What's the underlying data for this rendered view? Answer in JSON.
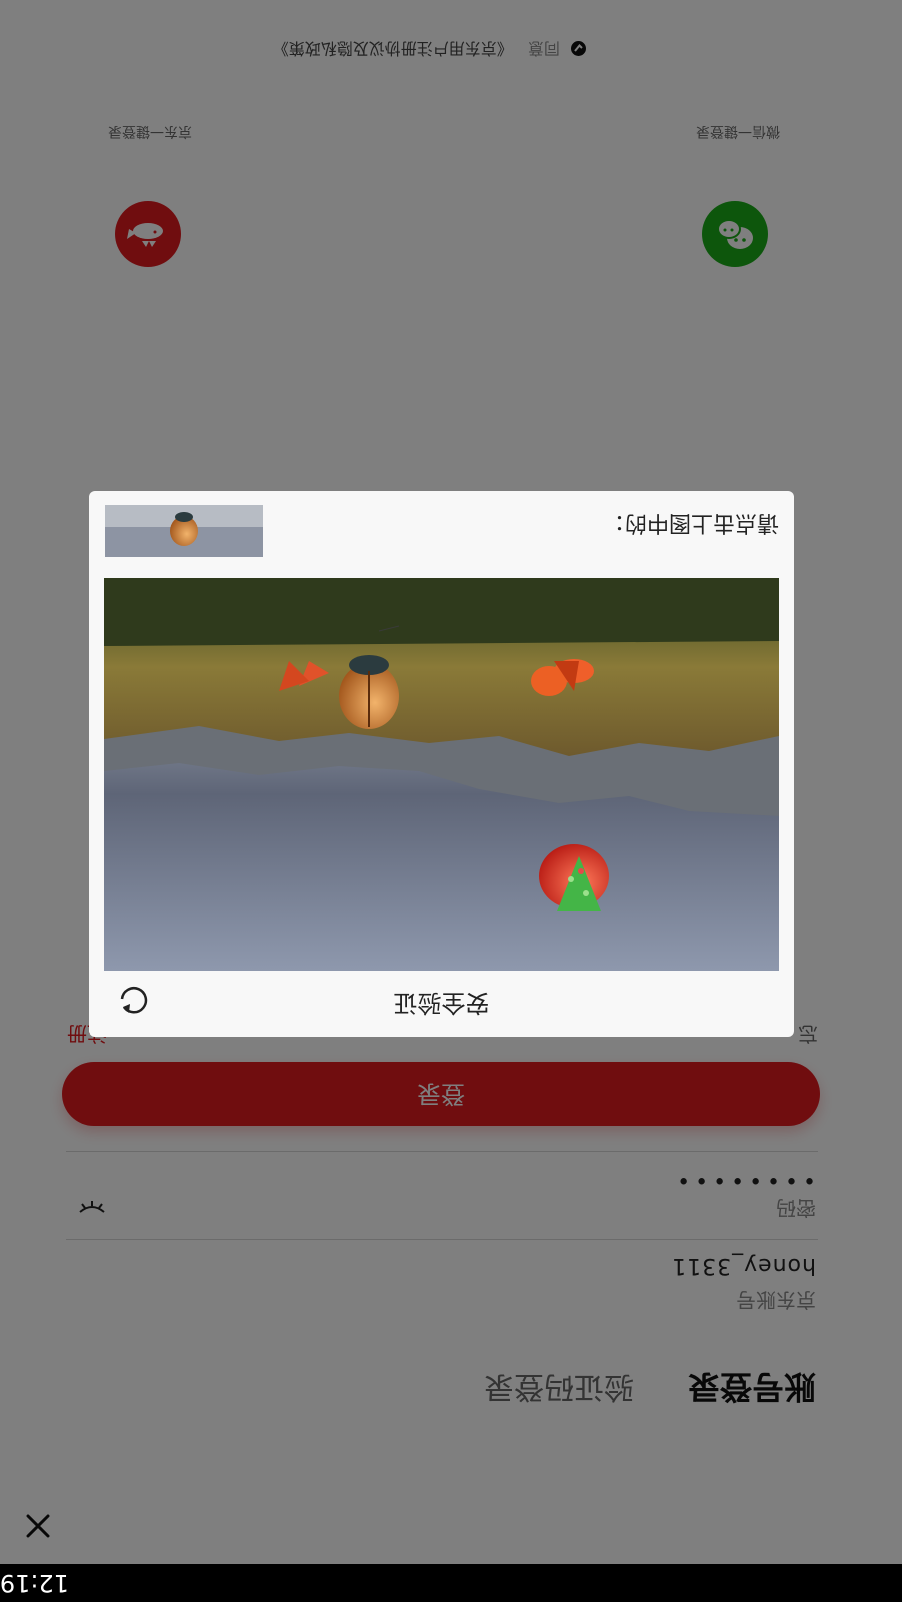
{
  "status_bar": {
    "time": "12:19"
  },
  "tabs": {
    "account_login": "账号登录",
    "sms_login": "验证码登录"
  },
  "form": {
    "account_label": "京东账号",
    "account_value": "honey_3311",
    "password_label": "密码",
    "password_value": "••••••••",
    "login_button": "登录",
    "forgot_partial": "忘",
    "register_partial": "注册"
  },
  "social": {
    "wechat_label": "微信一键登录",
    "jd_label": "京东一键登录"
  },
  "agreement": {
    "prefix": "同意",
    "document": "《京东用户注册协议及隐私政策》"
  },
  "captcha": {
    "title": "安全验证",
    "prompt": "请点击上图中的："
  },
  "icons": [
    "close-icon",
    "eye-closed-icon",
    "refresh-icon",
    "wechat-icon",
    "jd-icon",
    "check-icon"
  ],
  "colors": {
    "brand_red": "#e01a1f",
    "wechat_green": "#1aac19"
  }
}
